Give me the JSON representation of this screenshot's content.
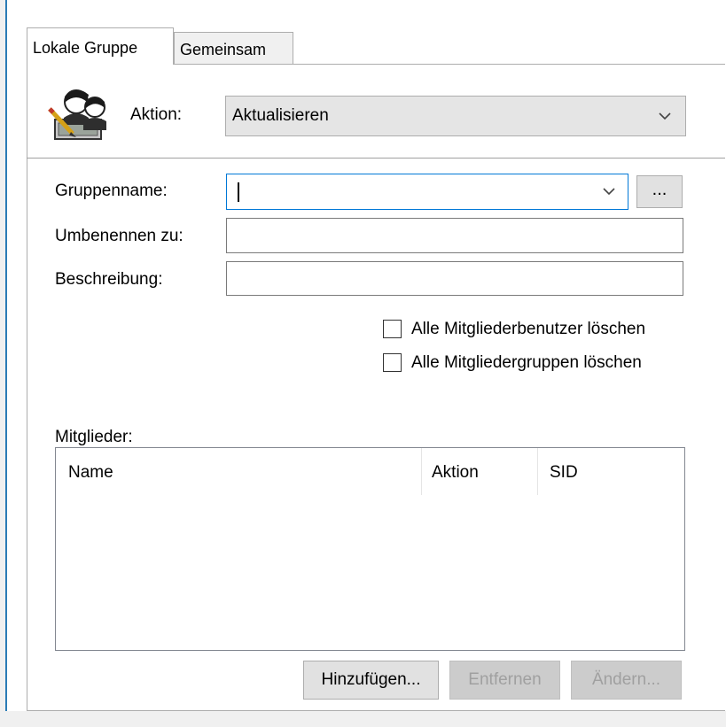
{
  "tabs": [
    {
      "label": "Lokale Gruppe",
      "active": true
    },
    {
      "label": "Gemeinsam",
      "active": false
    }
  ],
  "header": {
    "icon": "group-policy-users-icon",
    "aktion_label": "Aktion:",
    "aktion_value": "Aktualisieren"
  },
  "form": {
    "gruppenname_label": "Gruppenname:",
    "gruppenname_value": "",
    "browse_label": "...",
    "umbenennen_label": "Umbenennen zu:",
    "umbenennen_value": "",
    "beschreibung_label": "Beschreibung:",
    "beschreibung_value": "",
    "checkbox_users_label": "Alle Mitgliederbenutzer löschen",
    "checkbox_users_checked": false,
    "checkbox_groups_label": "Alle Mitgliedergruppen löschen",
    "checkbox_groups_checked": false
  },
  "members": {
    "label": "Mitglieder:",
    "columns": [
      "Name",
      "Aktion",
      "SID"
    ],
    "rows": []
  },
  "buttons": {
    "add": "Hinzufügen...",
    "remove": "Entfernen",
    "change": "Ändern..."
  },
  "colors": {
    "accent": "#0078d7",
    "left_bar_line": "#2b7cb6",
    "disabled_text": "#a0a0a0"
  }
}
